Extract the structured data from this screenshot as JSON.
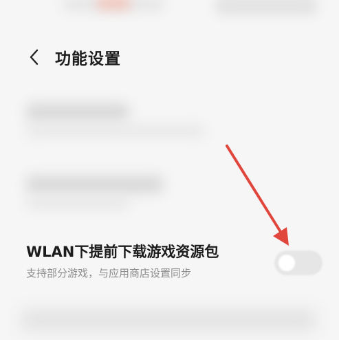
{
  "header": {
    "title": "功能设置",
    "back_icon": "chevron-left-icon"
  },
  "setting": {
    "title": "WLAN下提前下载游戏资源包",
    "subtitle": "支持部分游戏，与应用商店设置同步",
    "toggle_on": false
  },
  "annotation": {
    "arrow_color": "#e0463c"
  },
  "colors": {
    "background": "#f6f6f6",
    "toggle_off": "#e6e6e6"
  }
}
